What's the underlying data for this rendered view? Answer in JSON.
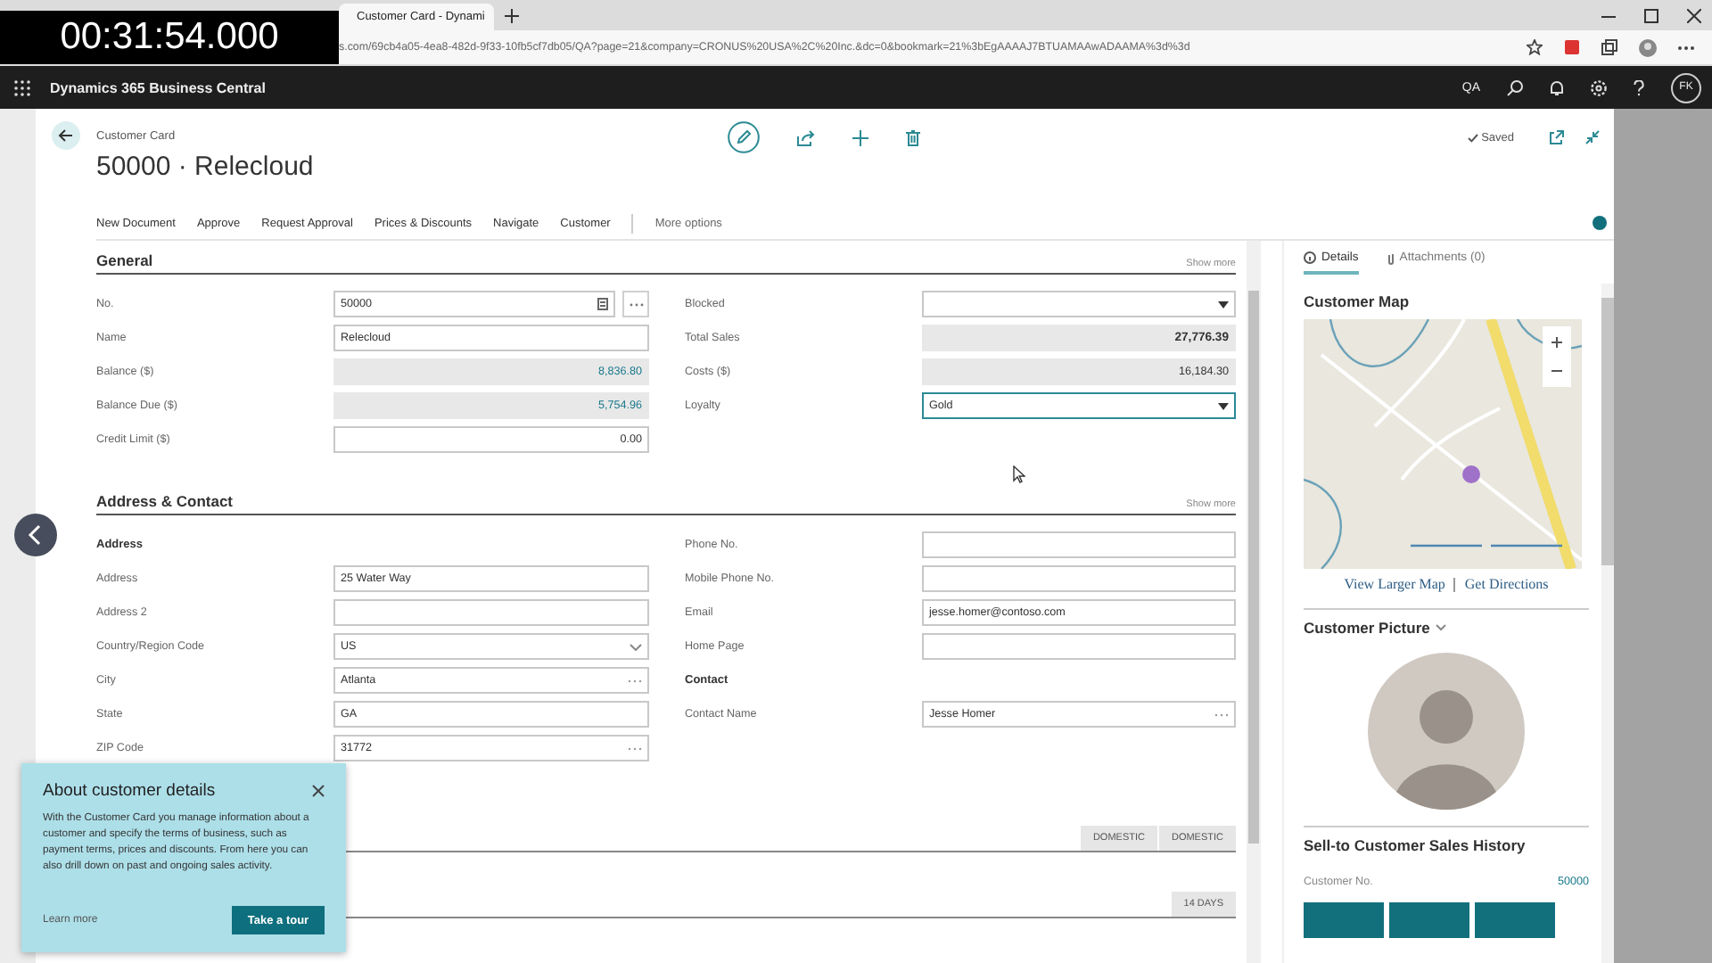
{
  "video_overlay": {
    "timestamp": "00:31:54.000"
  },
  "browser": {
    "tabs": [
      {
        "title": "Customer Card - Dynami",
        "selected": true
      }
    ],
    "address": "s.com/69cb4a05-4ea8-482d-9f33-10fb5cf7db05/QA?page=21&company=CRONUS%20USA%2C%20Inc.&dc=0&bookmark=21%3bEgAAAAJ7BTUAMAAwADAAMA%3d%3d"
  },
  "app_bar": {
    "title": "Dynamics 365 Business Central",
    "company": "QA",
    "user_initials": "FK"
  },
  "page": {
    "caption": "Customer Card",
    "title": "50000 · Relecloud",
    "status": "Saved",
    "actions": [
      "New Document",
      "Approve",
      "Request Approval",
      "Prices & Discounts",
      "Navigate",
      "Customer"
    ],
    "more_actions": "More options"
  },
  "sections": [
    {
      "title": "General",
      "show_more": "Show more",
      "left": [
        {
          "label": "No.",
          "value": "50000",
          "kind": "assist"
        },
        {
          "label": "Name",
          "value": "Relecloud",
          "kind": "text"
        },
        {
          "label": "Balance ($)",
          "value": "8,836.80",
          "kind": "flowfield"
        },
        {
          "label": "Balance Due ($)",
          "value": "5,754.96",
          "kind": "flowfield"
        },
        {
          "label": "Credit Limit ($)",
          "value": "0.00",
          "kind": "number"
        }
      ],
      "right": [
        {
          "label": "Blocked",
          "kind": "dropdown"
        },
        {
          "label": "Total Sales",
          "value": "27,776.39",
          "kind": "total"
        },
        {
          "label": "Costs ($)",
          "value": "16,184.30",
          "kind": "readonly"
        },
        {
          "label": "Loyalty",
          "value": "Gold",
          "kind": "dropdown"
        }
      ]
    },
    {
      "title": "Address & Contact",
      "show_more": "Show more",
      "left": [
        {
          "label": "Address",
          "kind": "heading"
        },
        {
          "label": "Address",
          "value": "25 Water Way",
          "kind": "text"
        },
        {
          "label": "Address 2",
          "kind": "text"
        },
        {
          "label": "Country/Region Code",
          "value": "US",
          "kind": "combo"
        },
        {
          "label": "City",
          "value": "Atlanta",
          "kind": "lookup"
        },
        {
          "label": "State",
          "value": "GA",
          "kind": "text"
        },
        {
          "label": "ZIP Code",
          "value": "31772",
          "kind": "lookup"
        }
      ],
      "right": [
        {
          "label": "Phone No.",
          "kind": "text"
        },
        {
          "label": "Mobile Phone No.",
          "kind": "text"
        },
        {
          "label": "Email",
          "value": "jesse.homer@contoso.com",
          "kind": "text"
        },
        {
          "label": "Home Page",
          "kind": "text"
        },
        {
          "label": "Contact",
          "kind": "heading"
        },
        {
          "label": "Contact Name",
          "value": "Jesse Homer",
          "kind": "lookup"
        }
      ]
    }
  ],
  "collapsed_sections": [
    {
      "badges": [
        "DOMESTIC",
        "DOMESTIC"
      ]
    },
    {
      "badges": [
        "14 DAYS"
      ]
    }
  ],
  "teaching_tip": {
    "title": "About customer details",
    "body": "With the Customer Card you manage information about a customer and specify the terms of business, such as payment terms, prices and discounts. From here you can also drill down on past and ongoing sales activity.",
    "link": "Learn more",
    "button": "Take a tour"
  },
  "factbox": {
    "tabs": [
      {
        "label": "Details",
        "selected": true
      },
      {
        "label": "Attachments (0)",
        "selected": false
      }
    ],
    "map_title": "Customer Map",
    "map_links": [
      "View Larger Map",
      "Get Directions"
    ],
    "picture_title": "Customer Picture",
    "history_title": "Sell-to Customer Sales History",
    "history_rows": [
      {
        "label": "Customer No.",
        "value": "50000"
      }
    ]
  }
}
